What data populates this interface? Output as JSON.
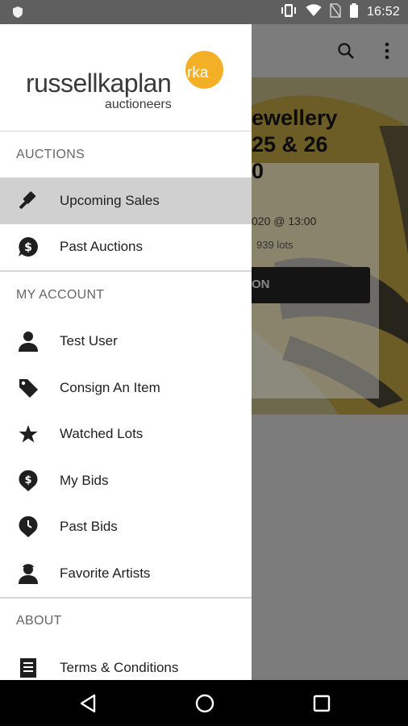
{
  "status_bar": {
    "time": "16:52",
    "icons": [
      "shield-icon",
      "vibrate-icon",
      "wifi-icon",
      "no-sim-icon",
      "battery-icon"
    ]
  },
  "toolbar": {
    "icons": [
      "search-icon",
      "overflow-menu-icon"
    ]
  },
  "background_card": {
    "title_line1": "ewellery",
    "title_line2": "25 & 26",
    "title_line3": "0",
    "date": "020 @ 13:00",
    "lots": "939 lots",
    "button_label": "ON"
  },
  "drawer": {
    "logo": {
      "name_part1": "russell",
      "name_part2": "kaplan",
      "subtitle": "auctioneers",
      "badge": "rka",
      "brand_color": "#f3b027"
    },
    "sections": {
      "auctions": "AUCTIONS",
      "my_account": "MY ACCOUNT",
      "about": "ABOUT"
    },
    "auctions_items": [
      {
        "label": "Upcoming Sales",
        "icon": "gavel-icon",
        "active": true
      },
      {
        "label": "Past Auctions",
        "icon": "dollar-bubble-icon",
        "active": false
      }
    ],
    "account_items": [
      {
        "label": "Test User",
        "icon": "person-icon"
      },
      {
        "label": "Consign An Item",
        "icon": "tag-icon"
      },
      {
        "label": "Watched Lots",
        "icon": "star-icon"
      },
      {
        "label": "My Bids",
        "icon": "dollar-pin-icon"
      },
      {
        "label": "Past Bids",
        "icon": "clock-pin-icon"
      },
      {
        "label": "Favorite Artists",
        "icon": "artist-icon"
      }
    ],
    "about_items": [
      {
        "label": "Terms & Conditions",
        "icon": "document-icon"
      }
    ]
  },
  "nav_bar": {
    "buttons": [
      "back-icon",
      "home-icon",
      "recents-icon"
    ]
  },
  "colors": {
    "status_bar": "#5f5f5f",
    "active_item": "#d0d0d0",
    "accent": "#f3b027"
  }
}
